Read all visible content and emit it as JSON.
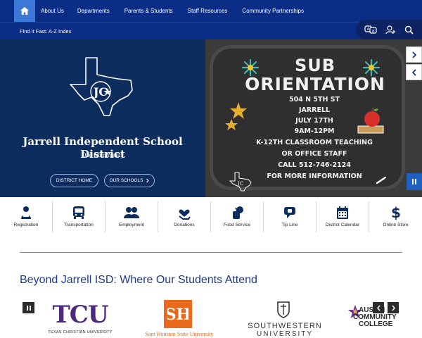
{
  "nav": {
    "items": [
      "About Us",
      "Departments",
      "Parents & Students",
      "Staff Resources",
      "Community Partnerships"
    ]
  },
  "subnav": {
    "quicklink": "Find it Fast: A-Z Index"
  },
  "utility": {
    "icons": [
      "translate-icon",
      "user-icon",
      "search-icon"
    ]
  },
  "hero": {
    "district_name": "Jarrell Independent School District",
    "tagline": "One Community",
    "buttons": {
      "home": "DISTRICT HOME",
      "schools": "OUR SCHOOLS"
    }
  },
  "slide": {
    "line1": "SUB",
    "line2": "ORIENTATION",
    "address": "504 N 5TH ST",
    "city": "JARRELL",
    "date": "JULY 17TH",
    "time": "9AM-12PM",
    "role": "K-12TH CLASSROOM TEACHING",
    "role2": "OR OFFICE STAFF",
    "call": "CALL 512-746-2124",
    "more": "FOR MORE INFORMATION"
  },
  "quick_links": [
    "Registration",
    "Transportation",
    "Employment",
    "Donations",
    "Food Service",
    "Tip Line",
    "District Calendar",
    "Online Store"
  ],
  "section": {
    "title": "Beyond Jarrell ISD: Where Our Students Attend"
  },
  "logos": {
    "tcu": "TCU",
    "tcu_full": "TEXAS CHRISTIAN UNIVERSITY",
    "shsu": "Sam Houston State University",
    "southwestern": "SOUTHWESTERN",
    "southwestern2": "UNIVERSITY",
    "acc1": "AUSTIN",
    "acc2": "COMMUNITY",
    "acc3": "COLLEGE"
  },
  "colors": {
    "nav": "#0a2d86",
    "home": "#3c78d8",
    "hero": "#0d2d5f",
    "title": "#1b3a8c",
    "tcu": "#4d2a7e",
    "shsu": "#e96a1b"
  }
}
